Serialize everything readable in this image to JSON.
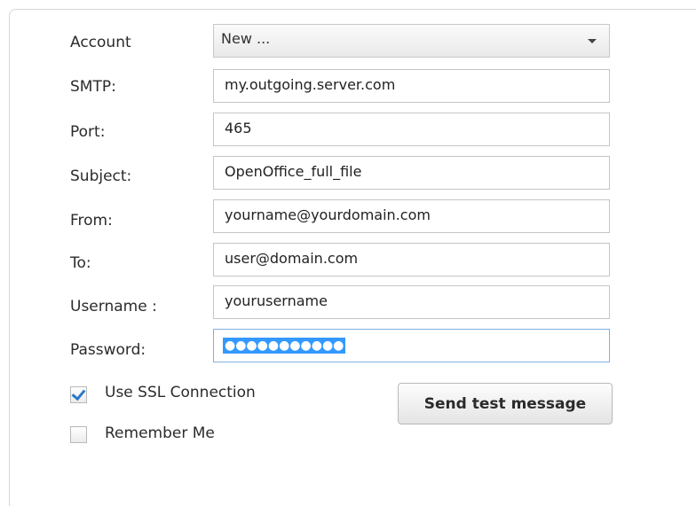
{
  "form": {
    "account": {
      "label": "Account",
      "value": "New ..."
    },
    "smtp": {
      "label": "SMTP:",
      "value": "my.outgoing.server.com"
    },
    "port": {
      "label": "Port:",
      "value": "465"
    },
    "subject": {
      "label": "Subject:",
      "value": "OpenOffice_full_file"
    },
    "from": {
      "label": "From:",
      "value": "yourname@yourdomain.com"
    },
    "to": {
      "label": "To:",
      "value": "user@domain.com"
    },
    "username": {
      "label": "Username :",
      "value": "yourusername"
    },
    "password": {
      "label": "Password:",
      "masked": "●●●●●●●●●●●"
    },
    "ssl": {
      "label": "Use SSL Connection",
      "checked": true
    },
    "remember": {
      "label": "Remember Me",
      "checked": false
    },
    "send_button": "Send test message"
  },
  "colors": {
    "selection": "#3399ff",
    "check": "#2c79c7"
  }
}
